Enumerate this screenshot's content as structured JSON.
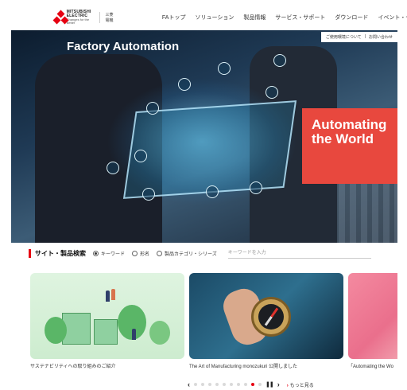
{
  "header": {
    "logo_line1": "MITSUBISHI ELECTRIC",
    "logo_line2": "Changes for the Better",
    "logo_ja": "三菱電機",
    "nav": [
      "FAトップ",
      "ソリューション",
      "製品情報",
      "サービス・サポート",
      "ダウンロード",
      "イベント・セミ"
    ]
  },
  "hero": {
    "title": "Factory Automation",
    "support_links": [
      "ご使用環境について",
      "お問い合わせ"
    ],
    "tagline_line1": "Automating",
    "tagline_line2": "the World"
  },
  "search": {
    "title": "サイト・製品検索",
    "options": [
      "キーワード",
      "形名",
      "製品カテゴリ・シリーズ"
    ],
    "selected": "キーワード",
    "placeholder": "キーワードを入力"
  },
  "carousel": {
    "cards": [
      {
        "caption": "サステナビリティへの取り組みのご紹介"
      },
      {
        "caption": "The Art of Manufacturing monozukuri 公開しました"
      },
      {
        "caption": "「Automating the Wo"
      }
    ],
    "dot_count": 10,
    "active_dot": 8,
    "prev_icon": "chevron-left",
    "next_icon": "chevron-right",
    "pause_icon": "pause",
    "more_label": "もっと見る"
  },
  "colors": {
    "brand_red": "#e60012",
    "tagline_panel": "#e8483e"
  }
}
